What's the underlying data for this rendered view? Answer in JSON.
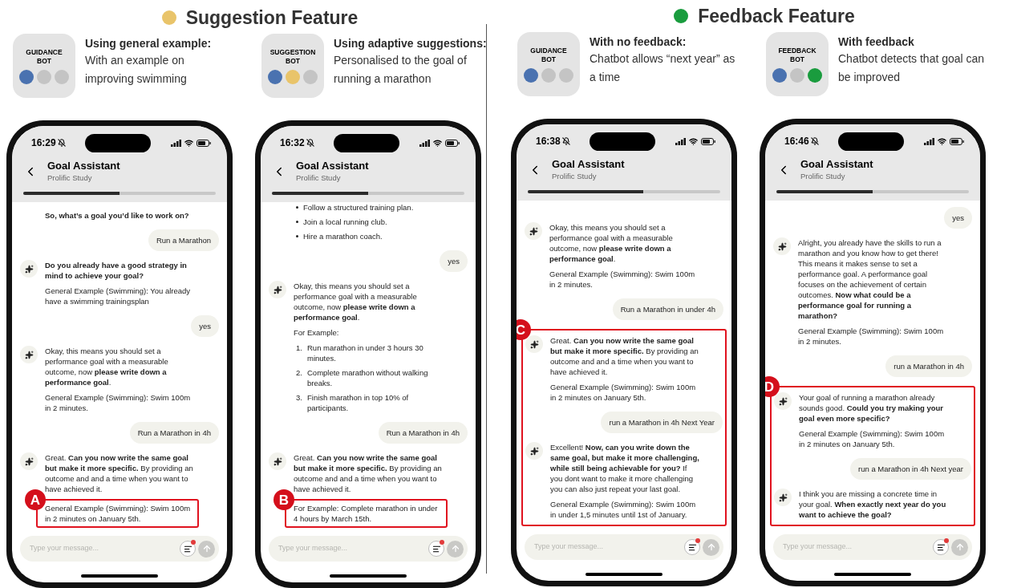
{
  "sections": [
    {
      "title": "Suggestion Feature",
      "color": "#e9c46a",
      "variants": [
        {
          "bot_label": "GUIDANCE BOT",
          "dots": [
            {
              "color": "#4a72b0"
            },
            {
              "color": "#c4c4c4"
            },
            {
              "color": "#c4c4c4"
            }
          ],
          "heading": "Using general example:",
          "description": "With an example on improving swimming",
          "phone": {
            "time": "16:29",
            "title": "Goal Assistant",
            "subtitle": "Prolific Study",
            "progress": {
              "level": 0.5
            },
            "placeholder": "Type your message...",
            "messages": [
              {
                "kind": "bot",
                "avatar": false,
                "paragraphs": [
                  {
                    "kind": "strong",
                    "text": "So, what’s a goal you’d like to work on?"
                  }
                ]
              },
              {
                "kind": "user",
                "text": "Run a Marathon"
              },
              {
                "kind": "bot",
                "avatar": true,
                "paragraphs": [
                  {
                    "kind": "strong",
                    "text": "Do you already have a good strategy in mind to achieve your goal?"
                  },
                  {
                    "kind": "text",
                    "text": "General Example (Swimming): You already have a swimming trainingsplan"
                  }
                ]
              },
              {
                "kind": "user",
                "text": "yes"
              },
              {
                "kind": "bot",
                "avatar": true,
                "paragraphs": [
                  {
                    "kind": "text",
                    "text": "Okay, this means you should set a performance goal with a measurable outcome, now **please write down a performance goal**."
                  },
                  {
                    "kind": "text",
                    "text": "General Example (Swimming): Swim 100m in 2 minutes."
                  }
                ]
              },
              {
                "kind": "user",
                "text": "Run a Marathon in 4h"
              },
              {
                "kind": "bot",
                "avatar": true,
                "paragraphs": [
                  {
                    "kind": "text",
                    "text": "Great. **Can you now write the same goal but make it more specific.** By providing an outcome and and a time when you want to have achieved it."
                  },
                  {
                    "kind": "text",
                    "text": "General Example (Swimming): Swim 100m in 2 minutes on January 5th.",
                    "marker": "A"
                  }
                ]
              }
            ]
          }
        },
        {
          "bot_label": "SUGGESTION BOT",
          "dots": [
            {
              "color": "#4a72b0"
            },
            {
              "color": "#e9c46a"
            },
            {
              "color": "#c4c4c4"
            }
          ],
          "heading": "Using adaptive suggestions:",
          "description": "Personalised to the goal of running a marathon",
          "phone": {
            "time": "16:32",
            "title": "Goal Assistant",
            "subtitle": "Prolific Study",
            "progress": {
              "level": 0.5
            },
            "placeholder": "Type your message...",
            "messages": [
              {
                "kind": "bot",
                "avatar": false,
                "paragraphs": [
                  {
                    "kind": "bullets",
                    "items": [
                      "Follow a structured training plan.",
                      "Join a local running club.",
                      "Hire a marathon coach."
                    ]
                  }
                ]
              },
              {
                "kind": "user",
                "text": "yes"
              },
              {
                "kind": "bot",
                "avatar": true,
                "paragraphs": [
                  {
                    "kind": "text",
                    "text": "Okay, this means you should set a performance goal with a measurable outcome, now **please write down a performance goal**."
                  },
                  {
                    "kind": "text",
                    "text": "For Example:"
                  },
                  {
                    "kind": "numbered",
                    "items": [
                      {
                        "number": "1.",
                        "text": "Run marathon in under 3 hours 30 minutes."
                      },
                      {
                        "number": "2.",
                        "text": "Complete marathon without walking breaks."
                      },
                      {
                        "number": "3.",
                        "text": "Finish marathon in top 10% of participants."
                      }
                    ]
                  }
                ]
              },
              {
                "kind": "user",
                "text": "Run a Marathon in 4h"
              },
              {
                "kind": "bot",
                "avatar": true,
                "paragraphs": [
                  {
                    "kind": "text",
                    "text": "Great. **Can you now write the same goal but make it more specific.** By providing an outcome and and a time when you want to have achieved it."
                  },
                  {
                    "kind": "text",
                    "text": "For Example: Complete marathon in under 4 hours by March 15th.",
                    "marker": "B"
                  }
                ]
              }
            ]
          }
        }
      ]
    },
    {
      "title": "Feedback Feature",
      "color": "#1a9c3e",
      "variants": [
        {
          "bot_label": "GUIDANCE BOT",
          "dots": [
            {
              "color": "#4a72b0"
            },
            {
              "color": "#c4c4c4"
            },
            {
              "color": "#c4c4c4"
            }
          ],
          "heading": "With no feedback:",
          "description": "Chatbot allows “next year” as a time",
          "phone": {
            "time": "16:38",
            "title": "Goal Assistant",
            "subtitle": "Prolific Study",
            "progress": {
              "level": 0.6
            },
            "placeholder": "Type your message...",
            "messages": [
              {
                "kind": "bot",
                "avatar": true,
                "paragraphs": [
                  {
                    "kind": "text",
                    "text": "Okay, this means you should set a performance goal with a measurable outcome, now **please write down a performance goal**."
                  },
                  {
                    "kind": "text",
                    "text": "General Example (Swimming): Swim 100m in 2 minutes."
                  }
                ]
              },
              {
                "kind": "user",
                "text": "Run a Marathon in under 4h"
              },
              {
                "kind": "highlight",
                "marker": "C",
                "messages": [
                  {
                    "kind": "bot",
                    "avatar": true,
                    "paragraphs": [
                      {
                        "kind": "text",
                        "text": "Great. **Can you now write the same goal but make it more specific.** By providing an outcome and and a time when you want to have achieved it."
                      },
                      {
                        "kind": "text",
                        "text": "General Example (Swimming): Swim 100m in 2 minutes on January 5th."
                      }
                    ]
                  },
                  {
                    "kind": "user",
                    "text": "run a Marathon in 4h Next Year"
                  },
                  {
                    "kind": "bot",
                    "avatar": true,
                    "paragraphs": [
                      {
                        "kind": "text",
                        "text": "Excellent! **Now, can you write down the same goal, but make it more challenging, while still being achievable for you?** If you dont want to make it more challenging you can also just repeat your last goal."
                      },
                      {
                        "kind": "text",
                        "text": "General Example (Swimming): Swim 100m in under 1,5 minutes until 1st of January."
                      }
                    ]
                  }
                ]
              }
            ]
          }
        },
        {
          "bot_label": "FEEDBACK BOT",
          "dots": [
            {
              "color": "#4a72b0"
            },
            {
              "color": "#c4c4c4"
            },
            {
              "color": "#1a9c3e"
            }
          ],
          "heading": "With feedback",
          "description": "Chatbot detects that goal can be improved",
          "phone": {
            "time": "16:46",
            "title": "Goal Assistant",
            "subtitle": "Prolific Study",
            "progress": {
              "level": 0.5
            },
            "placeholder": "Type your message...",
            "messages": [
              {
                "kind": "user",
                "text": "yes"
              },
              {
                "kind": "bot",
                "avatar": true,
                "paragraphs": [
                  {
                    "kind": "text",
                    "text": "Alright, you already have the skills to run a marathon and you know how to get there! This means it makes sense to set a performance goal. A performance goal focuses on the achievement of certain outcomes. **Now what could be a performance goal for running a marathon?**"
                  },
                  {
                    "kind": "text",
                    "text": "General Example (Swimming): Swim 100m in 2 minutes."
                  }
                ]
              },
              {
                "kind": "user",
                "text": "run a Marathon in 4h"
              },
              {
                "kind": "highlight",
                "marker": "D",
                "messages": [
                  {
                    "kind": "bot",
                    "avatar": true,
                    "paragraphs": [
                      {
                        "kind": "text",
                        "text": "Your goal of running a marathon already sounds good. **Could you try making your goal even more specific?**"
                      },
                      {
                        "kind": "text",
                        "text": "General Example (Swimming): Swim 100m in 2 minutes on January 5th."
                      }
                    ]
                  },
                  {
                    "kind": "user",
                    "text": "run a Marathon in 4h Next year"
                  },
                  {
                    "kind": "bot",
                    "avatar": true,
                    "paragraphs": [
                      {
                        "kind": "text",
                        "text": "I think you are missing a concrete time in your goal. **When exactly next year do you want to achieve the goal?**"
                      }
                    ]
                  }
                ]
              }
            ]
          }
        }
      ]
    }
  ]
}
